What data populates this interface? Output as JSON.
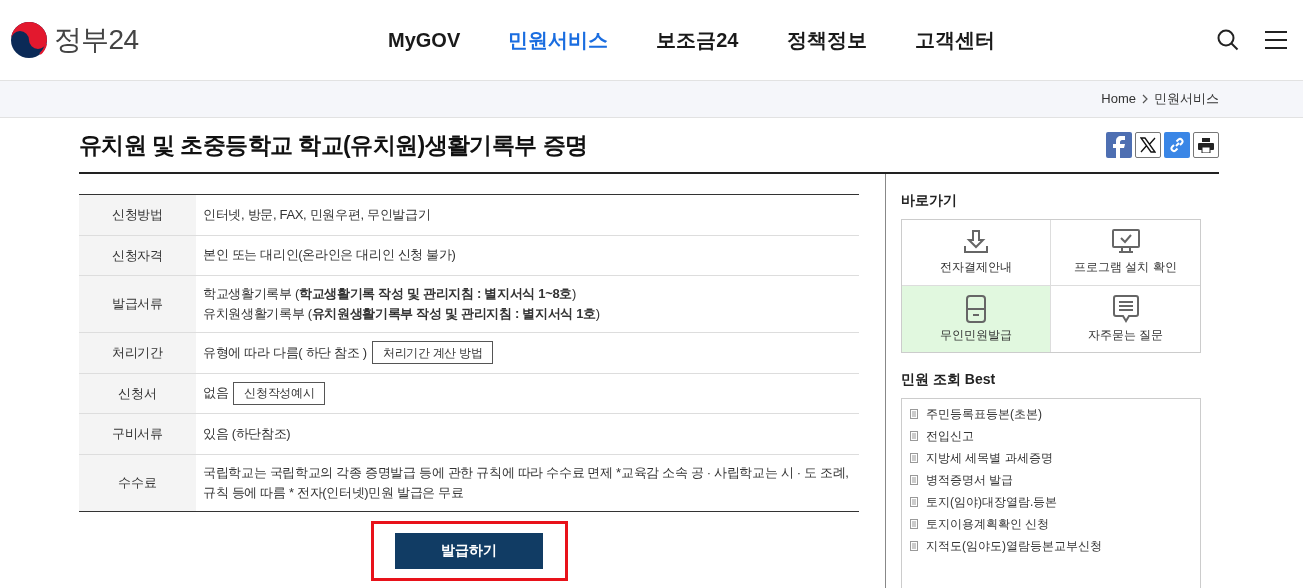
{
  "header": {
    "logo_text": "정부24",
    "nav": [
      {
        "label": "MyGOV",
        "selected": false
      },
      {
        "label": "민원서비스",
        "selected": true
      },
      {
        "label": "보조금24",
        "selected": false
      },
      {
        "label": "정책정보",
        "selected": false
      },
      {
        "label": "고객센터",
        "selected": false
      }
    ]
  },
  "breadcrumb": [
    "Home",
    "민원서비스"
  ],
  "page_title": "유치원 및 초중등학교 학교(유치원)생활기록부 증명",
  "info_table": [
    {
      "label": "신청방법",
      "lines": [
        "인터넷, 방문, FAX, 민원우편, 무인발급기"
      ]
    },
    {
      "label": "신청자격",
      "lines": [
        "본인 또는 대리인(온라인은 대리인 신청 불가)"
      ]
    },
    {
      "label": "발급서류",
      "lines": [
        "학교생활기록부 (**학교생활기록 작성 및 관리지침 : 별지서식 1~8호**)",
        "유치원생활기록부 (**유치원생활기록부 작성 및 관리지침 : 별지서식 1호**)"
      ]
    },
    {
      "label": "처리기간",
      "lines": [
        "유형에 따라 다름( 하단 참조 )"
      ],
      "button": "처리기간 계산 방법"
    },
    {
      "label": "신청서",
      "lines": [
        "없음"
      ],
      "button": "신청작성예시"
    },
    {
      "label": "구비서류",
      "lines": [
        "있음 (하단참조)"
      ]
    },
    {
      "label": "수수료",
      "lines": [
        "국립학교는 국립학교의 각종 증명발급 등에 관한 규칙에 따라 수수료 면제 *교육감 소속 공 · 사립학교는 시 · 도 조례, 규칙 등에 따름 * 전자(인터넷)민원 발급은 무료"
      ]
    }
  ],
  "issue_button": "발급하기",
  "sidebar": {
    "shortcuts_title": "바로가기",
    "shortcuts": [
      {
        "kind": "download",
        "label": "전자결제안내",
        "selected": false
      },
      {
        "kind": "monitor",
        "label": "프로그램 설치 확인",
        "selected": false
      },
      {
        "kind": "kiosk",
        "label": "무인민원발급",
        "selected": true
      },
      {
        "kind": "chat",
        "label": "자주묻는 질문",
        "selected": false
      }
    ],
    "best_title": "민원 조회 Best",
    "best": [
      "주민등록표등본(초본)",
      "전입신고",
      "지방세 세목별 과세증명",
      "병적증명서 발급",
      "토지(임야)대장열람.등본",
      "토지이용계획확인 신청",
      "지적도(임야도)열람등본교부신청"
    ]
  }
}
